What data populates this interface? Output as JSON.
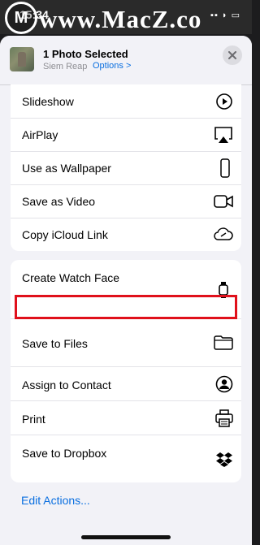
{
  "status_bar": {
    "time": "15:34",
    "indicators": "▪▪ ◗ ▭"
  },
  "watermark": {
    "logo": "M",
    "text": "www.MacZ.co"
  },
  "header": {
    "title": "1 Photo Selected",
    "location": "Siem Reap",
    "options_label": "Options >",
    "close_icon": "close-icon"
  },
  "group1": {
    "items": [
      {
        "label": "Slideshow",
        "icon": "play-circle-icon"
      },
      {
        "label": "AirPlay",
        "icon": "airplay-icon"
      },
      {
        "label": "Use as Wallpaper",
        "icon": "phone-icon"
      },
      {
        "label": "Save as Video",
        "icon": "video-icon"
      },
      {
        "label": "Copy iCloud Link",
        "icon": "cloud-link-icon"
      }
    ]
  },
  "group2": {
    "items": [
      {
        "label": "Create Watch Face",
        "icon": "watch-icon"
      },
      {
        "label": "Save to Files",
        "icon": "folder-icon",
        "highlighted": true
      },
      {
        "label": "Assign to Contact",
        "icon": "contact-icon"
      },
      {
        "label": "Print",
        "icon": "printer-icon"
      },
      {
        "label": "Save to Dropbox",
        "icon": "dropbox-icon"
      }
    ]
  },
  "footer": {
    "edit_actions": "Edit Actions..."
  },
  "colors": {
    "accent": "#0a6fe0",
    "highlight": "#e0101b",
    "sheet_bg": "#f2f2f7"
  }
}
